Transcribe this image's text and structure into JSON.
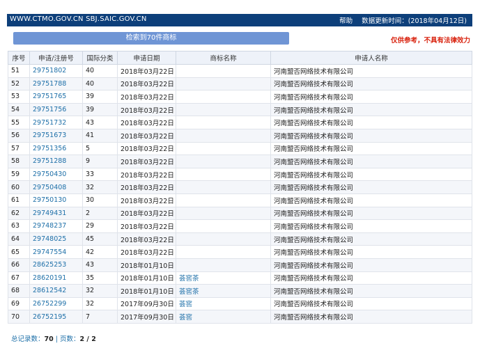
{
  "header": {
    "site_urls": "WWW.CTMO.GOV.CN SBJ.SAIC.GOV.CN",
    "help_link": "帮助",
    "update_label": "数据更新时间：(2018年04月12日)"
  },
  "search_summary_button": "检索到70件商标",
  "disclaimer": "仅供参考，不具有法律效力",
  "table": {
    "columns": [
      "序号",
      "申请/注册号",
      "国际分类",
      "申请日期",
      "商标名称",
      "申请人名称"
    ],
    "rows": [
      {
        "seq": "51",
        "reg_no": "29751802",
        "class": "40",
        "date": "2018年03月22日",
        "mark": "",
        "applicant": "河南盟否网络技术有限公司"
      },
      {
        "seq": "52",
        "reg_no": "29751788",
        "class": "40",
        "date": "2018年03月22日",
        "mark": "",
        "applicant": "河南盟否网络技术有限公司"
      },
      {
        "seq": "53",
        "reg_no": "29751765",
        "class": "39",
        "date": "2018年03月22日",
        "mark": "",
        "applicant": "河南盟否网络技术有限公司"
      },
      {
        "seq": "54",
        "reg_no": "29751756",
        "class": "39",
        "date": "2018年03月22日",
        "mark": "",
        "applicant": "河南盟否网络技术有限公司"
      },
      {
        "seq": "55",
        "reg_no": "29751732",
        "class": "43",
        "date": "2018年03月22日",
        "mark": "",
        "applicant": "河南盟否网络技术有限公司"
      },
      {
        "seq": "56",
        "reg_no": "29751673",
        "class": "41",
        "date": "2018年03月22日",
        "mark": "",
        "applicant": "河南盟否网络技术有限公司"
      },
      {
        "seq": "57",
        "reg_no": "29751356",
        "class": "5",
        "date": "2018年03月22日",
        "mark": "",
        "applicant": "河南盟否网络技术有限公司"
      },
      {
        "seq": "58",
        "reg_no": "29751288",
        "class": "9",
        "date": "2018年03月22日",
        "mark": "",
        "applicant": "河南盟否网络技术有限公司"
      },
      {
        "seq": "59",
        "reg_no": "29750430",
        "class": "33",
        "date": "2018年03月22日",
        "mark": "",
        "applicant": "河南盟否网络技术有限公司"
      },
      {
        "seq": "60",
        "reg_no": "29750408",
        "class": "32",
        "date": "2018年03月22日",
        "mark": "",
        "applicant": "河南盟否网络技术有限公司"
      },
      {
        "seq": "61",
        "reg_no": "29750130",
        "class": "30",
        "date": "2018年03月22日",
        "mark": "",
        "applicant": "河南盟否网络技术有限公司"
      },
      {
        "seq": "62",
        "reg_no": "29749431",
        "class": "2",
        "date": "2018年03月22日",
        "mark": "",
        "applicant": "河南盟否网络技术有限公司"
      },
      {
        "seq": "63",
        "reg_no": "29748237",
        "class": "29",
        "date": "2018年03月22日",
        "mark": "",
        "applicant": "河南盟否网络技术有限公司"
      },
      {
        "seq": "64",
        "reg_no": "29748025",
        "class": "45",
        "date": "2018年03月22日",
        "mark": "",
        "applicant": "河南盟否网络技术有限公司"
      },
      {
        "seq": "65",
        "reg_no": "29747554",
        "class": "42",
        "date": "2018年03月22日",
        "mark": "",
        "applicant": "河南盟否网络技术有限公司"
      },
      {
        "seq": "66",
        "reg_no": "28625253",
        "class": "43",
        "date": "2018年01月10日",
        "mark": "",
        "applicant": "河南盟否网络技术有限公司"
      },
      {
        "seq": "67",
        "reg_no": "28620191",
        "class": "35",
        "date": "2018年01月10日",
        "mark": "荟窖茶",
        "applicant": "河南盟否网络技术有限公司"
      },
      {
        "seq": "68",
        "reg_no": "28612542",
        "class": "32",
        "date": "2018年01月10日",
        "mark": "荟窖茶",
        "applicant": "河南盟否网络技术有限公司"
      },
      {
        "seq": "69",
        "reg_no": "26752299",
        "class": "32",
        "date": "2017年09月30日",
        "mark": "荟窖",
        "applicant": "河南盟否网络技术有限公司"
      },
      {
        "seq": "70",
        "reg_no": "26752195",
        "class": "7",
        "date": "2017年09月30日",
        "mark": "荟窖",
        "applicant": "河南盟否网络技术有限公司"
      }
    ]
  },
  "footer": {
    "total_label": "总记录数：",
    "total_value": "70",
    "separator": " | ",
    "page_label": "页数：",
    "page_value": "2 / 2"
  },
  "colors": {
    "header_bg": "#0d3f7a",
    "button_bg": "#6f95d5",
    "link": "#1d6fa8",
    "disclaimer": "#d9230f"
  }
}
